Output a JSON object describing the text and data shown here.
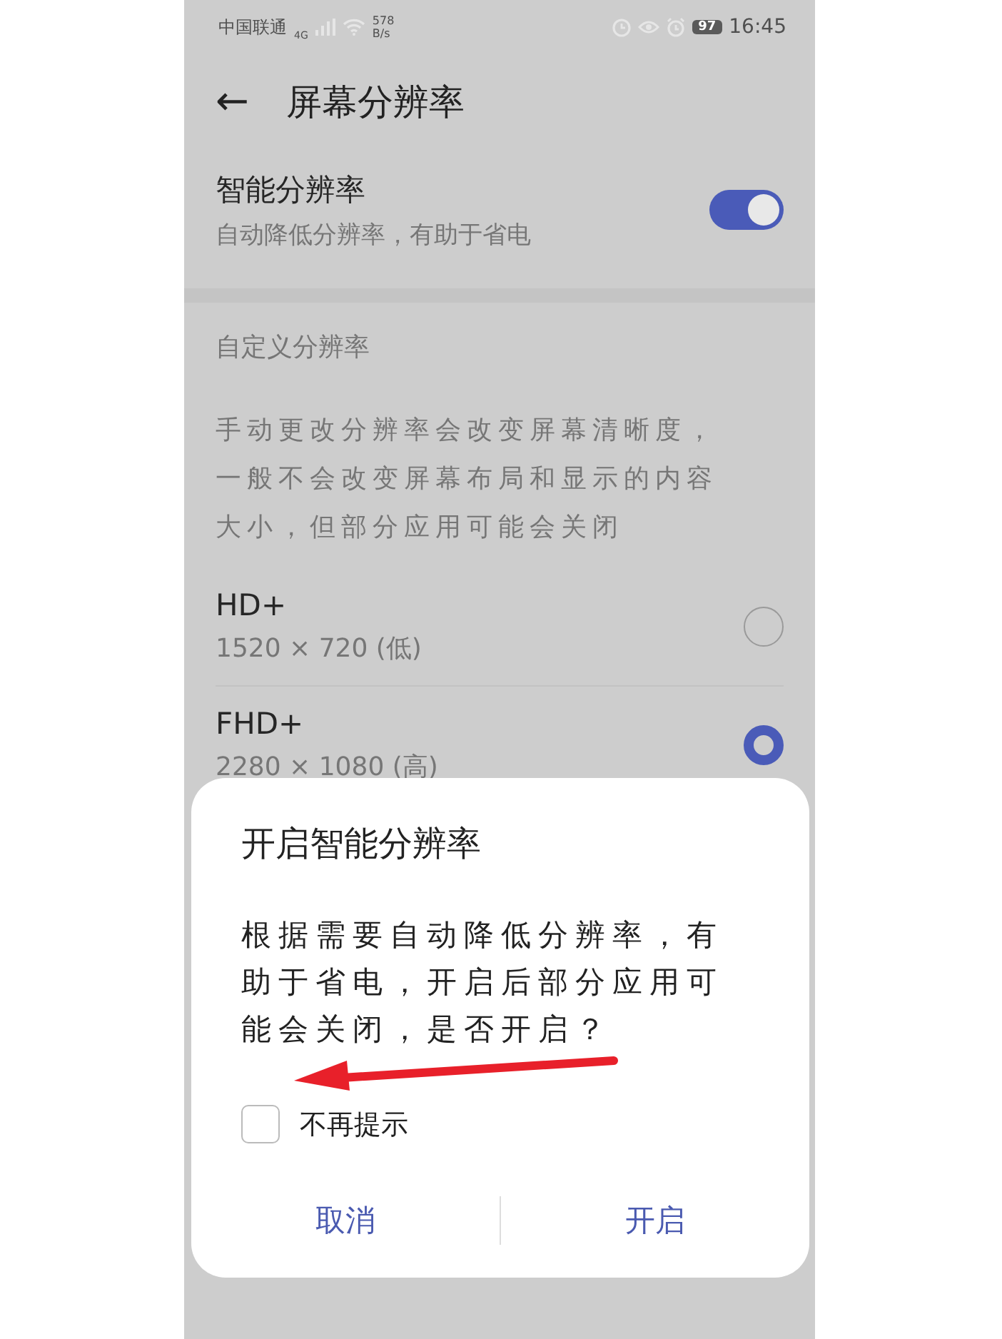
{
  "status_bar": {
    "carrier": "中国联通",
    "network": "4G",
    "speed": "578\nB/s",
    "battery": "97",
    "time": "16:45"
  },
  "header": {
    "back": "←",
    "title": "屏幕分辨率"
  },
  "smart_resolution": {
    "title": "智能分辨率",
    "subtitle": "自动降低分辨率，有助于省电",
    "on": true
  },
  "section": {
    "label": "自定义分辨率",
    "description": "手动更改分辨率会改变屏幕清晰度，一般不会改变屏幕布局和显示的内容大小，但部分应用可能会关闭"
  },
  "options": [
    {
      "name": "HD+",
      "detail": "1520 × 720 (低)",
      "selected": false
    },
    {
      "name": "FHD+",
      "detail": "2280 × 1080 (高)",
      "selected": true
    }
  ],
  "dialog": {
    "title": "开启智能分辨率",
    "message": "根据需要自动降低分辨率，有助于省电，开启后部分应用可能会关闭，是否开启？",
    "checkbox": {
      "label": "不再提示",
      "checked": false
    },
    "buttons": [
      "取消",
      "开启"
    ]
  }
}
